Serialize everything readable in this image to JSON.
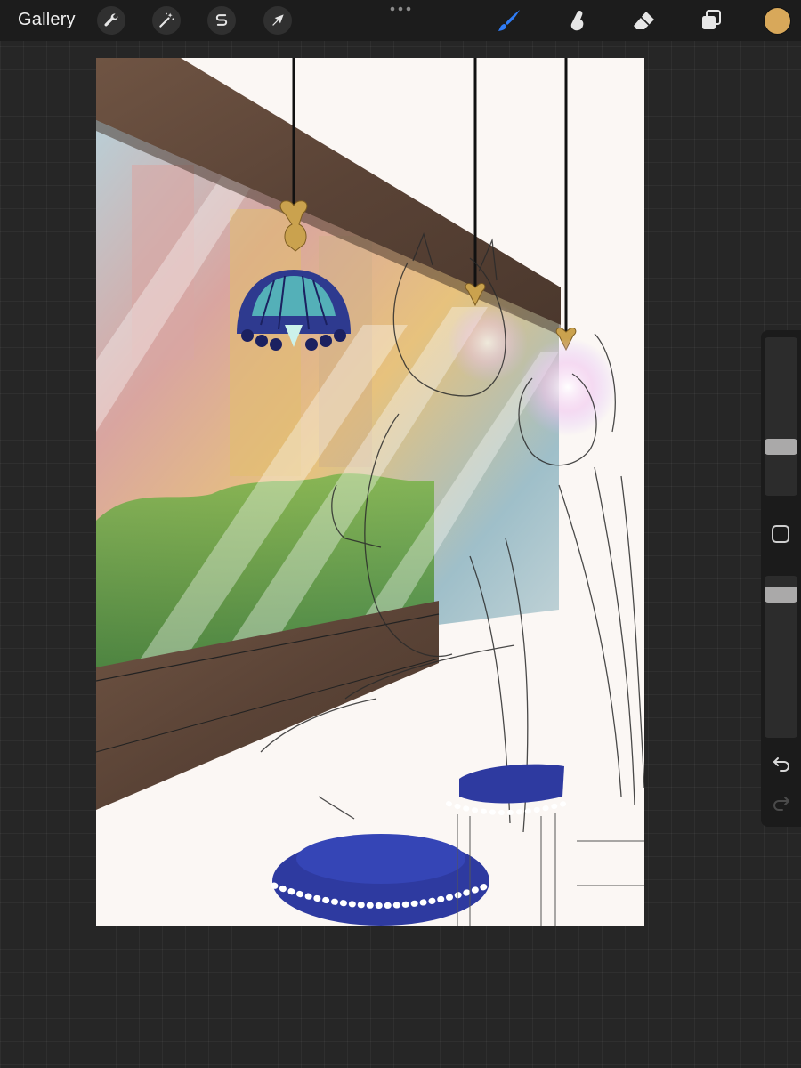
{
  "app": {
    "gallery_label": "Gallery"
  },
  "toolbar_left": [
    {
      "name": "actions",
      "icon": "wrench-icon"
    },
    {
      "name": "adjustments",
      "icon": "magic-wand-icon"
    },
    {
      "name": "selection",
      "icon": "selection-s-icon"
    },
    {
      "name": "transform",
      "icon": "arrow-cursor-icon"
    }
  ],
  "toolbar_right": [
    {
      "name": "brush",
      "icon": "brush-icon",
      "active": true
    },
    {
      "name": "smudge",
      "icon": "smudge-finger-icon"
    },
    {
      "name": "eraser",
      "icon": "eraser-icon"
    },
    {
      "name": "layers",
      "icon": "layers-icon"
    }
  ],
  "colors": {
    "active_tool": "#2f7cf6",
    "current_color": "#d8a85a",
    "background": "#262626",
    "toolbar": "#1c1c1c",
    "canvas": "#fbf7f4"
  },
  "sidebar": {
    "brush_size_slider": {
      "icon": "brush-size-slider"
    },
    "modify_button": {
      "icon": "square-modify-icon"
    },
    "opacity_slider": {
      "icon": "opacity-slider"
    },
    "undo": {
      "icon": "undo-icon"
    },
    "redo": {
      "icon": "redo-icon",
      "enabled": false
    }
  },
  "artwork": {
    "description_hidden": true
  }
}
